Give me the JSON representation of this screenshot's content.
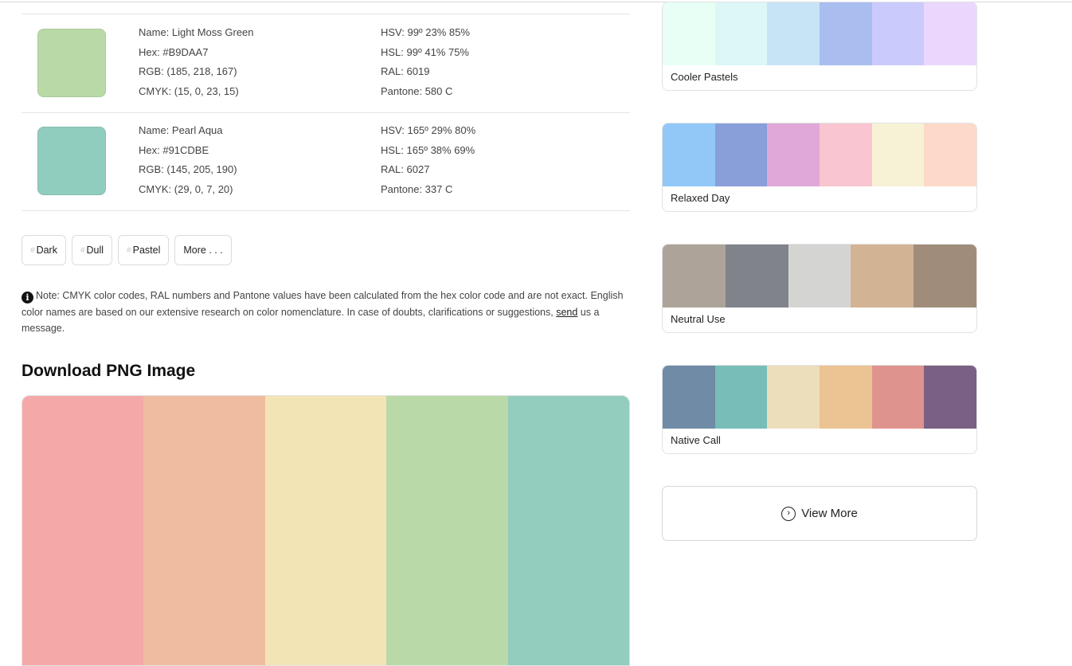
{
  "colors": [
    {
      "swatch": "#B9DAA7",
      "name": "Name: Light Moss Green",
      "hex": "Hex: #B9DAA7",
      "rgb": "RGB: (185, 218, 167)",
      "cmyk": "CMYK: (15, 0, 23, 15)",
      "hsv": "HSV: 99º 23% 85%",
      "hsl": "HSL: 99º 41% 75%",
      "ral": "RAL: 6019",
      "pantone": "Pantone: 580 C"
    },
    {
      "swatch": "#91CDBE",
      "name": "Name: Pearl Aqua",
      "hex": "Hex: #91CDBE",
      "rgb": "RGB: (145, 205, 190)",
      "cmyk": "CMYK: (29, 0, 7, 20)",
      "hsv": "HSV: 165º 29% 80%",
      "hsl": "HSL: 165º 38% 69%",
      "ral": "RAL: 6027",
      "pantone": "Pantone: 337 C"
    }
  ],
  "tags": {
    "hash": "#",
    "items": [
      "Dark",
      "Dull",
      "Pastel"
    ],
    "more": "More . . ."
  },
  "note": {
    "icon": "info-icon",
    "text_before": "Note: CMYK color codes, RAL numbers and Pantone values have been calculated from the hex color code and are not exact. English color names are based on our extensive research on color nomenclature. In case of doubts, clarifications or suggestions, ",
    "link": "send",
    "text_after": " us a message."
  },
  "download": {
    "title": "Download PNG Image",
    "colors": [
      "#F4A8A7",
      "#F0BCA0",
      "#F3E4B6",
      "#BAD9A8",
      "#92CDBD"
    ]
  },
  "palettes": [
    {
      "name": "Cooler Pastels",
      "colors": [
        "#E8FFF6",
        "#DDF6F6",
        "#C7E4F7",
        "#AABDEF",
        "#CACAFD",
        "#EBD7FE"
      ]
    },
    {
      "name": "Relaxed Day",
      "colors": [
        "#92C8F8",
        "#889FDA",
        "#E0A8D8",
        "#F8C5D0",
        "#F7F2D6",
        "#FDD9CA"
      ]
    },
    {
      "name": "Neutral Use",
      "colors": [
        "#ADA398",
        "#808389",
        "#D4D5D3",
        "#D2B394",
        "#9F8C7A"
      ]
    },
    {
      "name": "Native Call",
      "colors": [
        "#6F8BA6",
        "#78BDB8",
        "#ECDEBB",
        "#ECC494",
        "#DF938F",
        "#7A6083"
      ]
    }
  ],
  "view_more": "View More"
}
